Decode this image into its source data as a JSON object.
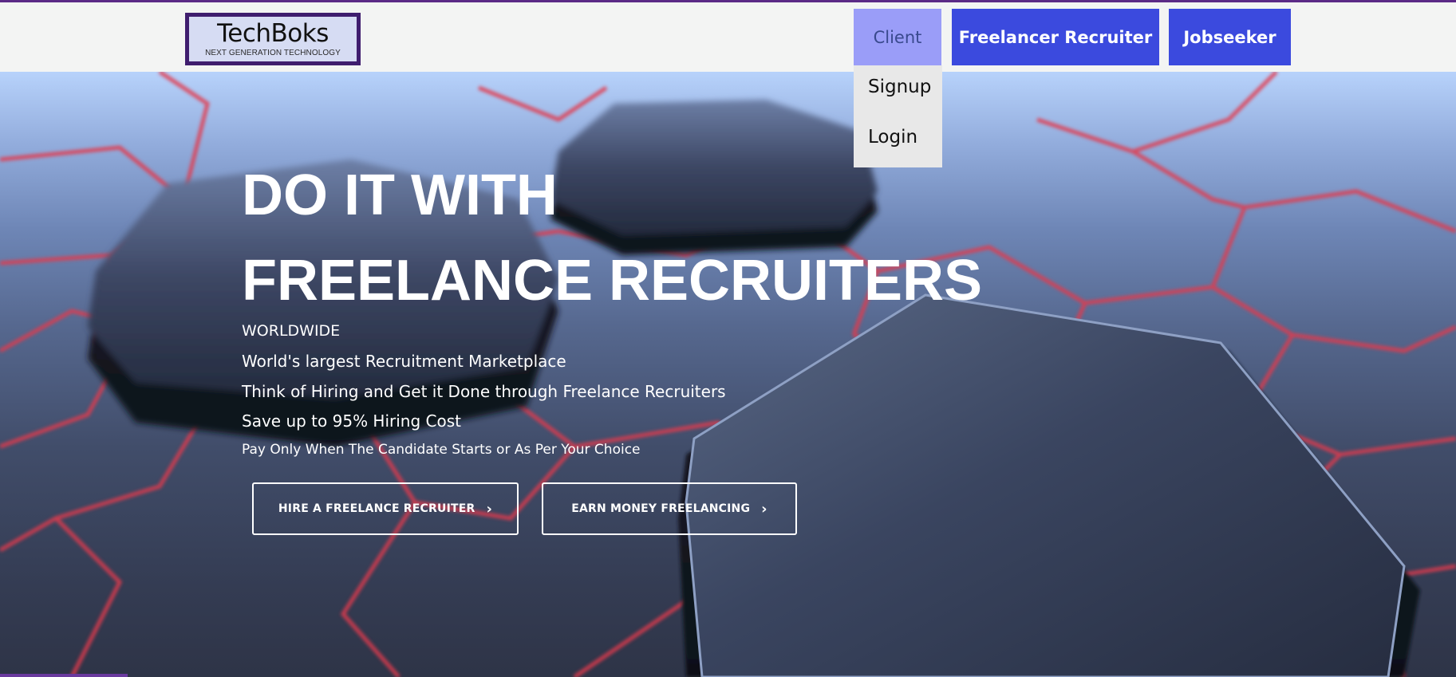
{
  "header": {
    "logo": {
      "name": "TechBoks",
      "tagline": "NEXT GENERATION TECHNOLOGY"
    },
    "nav": {
      "client": "Client",
      "freelancer_recruiter": "Freelancer Recruiter",
      "jobseeker": "Jobseeker"
    },
    "client_dropdown": {
      "items": [
        "Signup",
        "Login"
      ]
    }
  },
  "hero": {
    "title_line1": "DO IT WITH",
    "title_line2": "FREELANCE RECRUITERS",
    "lines": [
      "WORLDWIDE",
      "World's largest Recruitment Marketplace",
      "Think of Hiring and Get it Done through Freelance Recruiters",
      "Save up to 95% Hiring Cost",
      "Pay Only When The Candidate Starts or As Per Your Choice"
    ],
    "buttons": {
      "hire": "HIRE A FREELANCE RECRUITER",
      "earn": "EARN MONEY FREELANCING"
    }
  },
  "colors": {
    "accent_purple": "#5b2a86",
    "nav_blue": "#3b4ade",
    "nav_client_active": "#9a9df8",
    "header_bg": "#f3f4f3",
    "network_red": "#e23a4d"
  },
  "icons": {
    "cta_chevron": "chevron-right-icon"
  }
}
